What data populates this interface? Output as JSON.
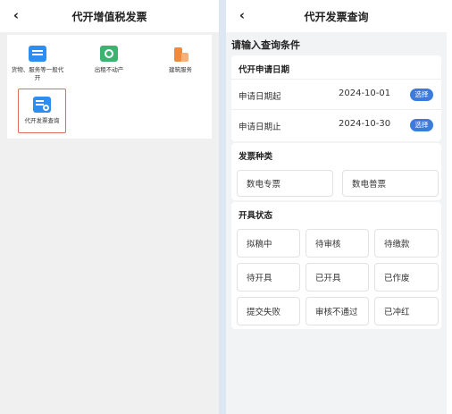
{
  "left": {
    "nav": {
      "back_icon": "chevron-left-icon",
      "back_glyph": "‹",
      "title": "代开增值税发票"
    },
    "services": [
      {
        "label": "货物、服务等一般代开",
        "icon": "invoice-icon",
        "color": "#2b8ef0"
      },
      {
        "label": "出租不动产",
        "icon": "property-icon",
        "color": "#3cb371"
      },
      {
        "label": "建筑服务",
        "icon": "building-icon",
        "color": "#f08a3c"
      },
      {
        "label": "代开发票查询",
        "icon": "invoice-query-icon",
        "color": "#2b8ef0",
        "selected": true
      }
    ]
  },
  "right": {
    "nav": {
      "back_icon": "chevron-left-icon",
      "back_glyph": "‹",
      "title": "代开发票查询"
    },
    "conditions_title": "请输入查询条件",
    "date_section": {
      "title": "代开申请日期",
      "start_label": "申请日期起",
      "start_value": "2024-10-01",
      "end_label": "申请日期止",
      "end_value": "2024-10-30",
      "select_label": "选择"
    },
    "type_section": {
      "title": "发票种类",
      "options": [
        "数电专票",
        "数电普票"
      ]
    },
    "status_section": {
      "title": "开具状态",
      "options": [
        "拟稿中",
        "待审核",
        "待缴款",
        "待开具",
        "已开具",
        "已作废",
        "提交失败",
        "审核不通过",
        "已冲红"
      ]
    },
    "accent_color": "#3a7bdc"
  }
}
